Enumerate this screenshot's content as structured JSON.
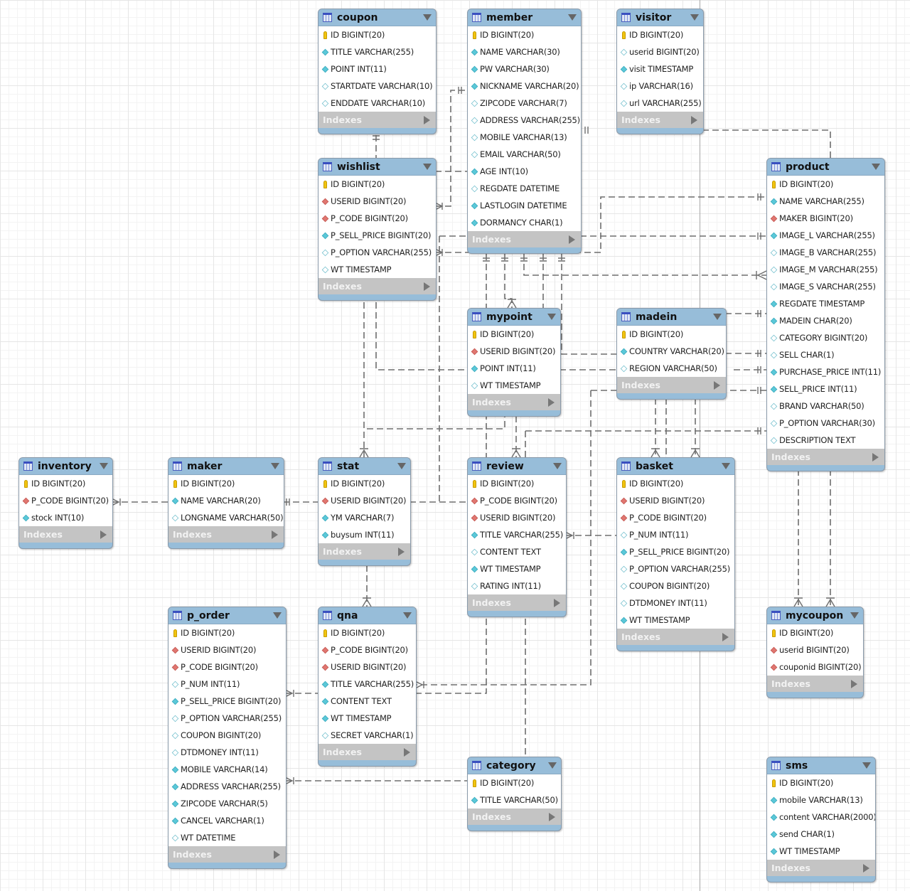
{
  "diagram": {
    "indexes_label": "Indexes",
    "colors": {
      "header": "#97bdd9",
      "primary_key": "#f1c40f",
      "foreign_key": "#e07670",
      "not_null": "#5bc8d8",
      "nullable": "#ffffff",
      "relationship_line": "#6e6e6e"
    },
    "tables": [
      {
        "name": "coupon",
        "columns": [
          {
            "text": "ID BIGINT(20)",
            "kind": "pk"
          },
          {
            "text": "TITLE VARCHAR(255)",
            "kind": "nn"
          },
          {
            "text": "POINT INT(11)",
            "kind": "nn"
          },
          {
            "text": "STARTDATE VARCHAR(10)",
            "kind": "nul"
          },
          {
            "text": "ENDDATE VARCHAR(10)",
            "kind": "nul"
          }
        ]
      },
      {
        "name": "member",
        "columns": [
          {
            "text": "ID BIGINT(20)",
            "kind": "pk"
          },
          {
            "text": "NAME VARCHAR(30)",
            "kind": "nn"
          },
          {
            "text": "PW VARCHAR(30)",
            "kind": "nn"
          },
          {
            "text": "NICKNAME VARCHAR(20)",
            "kind": "nn"
          },
          {
            "text": "ZIPCODE VARCHAR(7)",
            "kind": "nul"
          },
          {
            "text": "ADDRESS VARCHAR(255)",
            "kind": "nul"
          },
          {
            "text": "MOBILE VARCHAR(13)",
            "kind": "nul"
          },
          {
            "text": "EMAIL VARCHAR(50)",
            "kind": "nul"
          },
          {
            "text": "AGE INT(10)",
            "kind": "nn"
          },
          {
            "text": "REGDATE DATETIME",
            "kind": "nul"
          },
          {
            "text": "LASTLOGIN DATETIME",
            "kind": "nn"
          },
          {
            "text": "DORMANCY CHAR(1)",
            "kind": "nn"
          }
        ]
      },
      {
        "name": "visitor",
        "columns": [
          {
            "text": "ID BIGINT(20)",
            "kind": "pk"
          },
          {
            "text": "userid BIGINT(20)",
            "kind": "nul"
          },
          {
            "text": "visit TIMESTAMP",
            "kind": "nn"
          },
          {
            "text": "ip VARCHAR(16)",
            "kind": "nul"
          },
          {
            "text": "url VARCHAR(255)",
            "kind": "nul"
          }
        ]
      },
      {
        "name": "wishlist",
        "columns": [
          {
            "text": "ID BIGINT(20)",
            "kind": "pk"
          },
          {
            "text": "USERID BIGINT(20)",
            "kind": "fk"
          },
          {
            "text": "P_CODE BIGINT(20)",
            "kind": "fk"
          },
          {
            "text": "P_SELL_PRICE BIGINT(20)",
            "kind": "nn"
          },
          {
            "text": "P_OPTION VARCHAR(255)",
            "kind": "nul"
          },
          {
            "text": "WT TIMESTAMP",
            "kind": "nul"
          }
        ]
      },
      {
        "name": "product",
        "columns": [
          {
            "text": "ID BIGINT(20)",
            "kind": "pk"
          },
          {
            "text": "NAME VARCHAR(255)",
            "kind": "nn"
          },
          {
            "text": "MAKER BIGINT(20)",
            "kind": "fk"
          },
          {
            "text": "IMAGE_L VARCHAR(255)",
            "kind": "nn"
          },
          {
            "text": "IMAGE_B VARCHAR(255)",
            "kind": "nul"
          },
          {
            "text": "IMAGE_M VARCHAR(255)",
            "kind": "nul"
          },
          {
            "text": "IMAGE_S VARCHAR(255)",
            "kind": "nul"
          },
          {
            "text": "REGDATE TIMESTAMP",
            "kind": "nn"
          },
          {
            "text": "MADEIN CHAR(20)",
            "kind": "nn"
          },
          {
            "text": "CATEGORY BIGINT(20)",
            "kind": "nul"
          },
          {
            "text": "SELL CHAR(1)",
            "kind": "nul"
          },
          {
            "text": "PURCHASE_PRICE INT(11)",
            "kind": "nn"
          },
          {
            "text": "SELL_PRICE INT(11)",
            "kind": "nn"
          },
          {
            "text": "BRAND VARCHAR(50)",
            "kind": "nul"
          },
          {
            "text": "P_OPTION VARCHAR(30)",
            "kind": "nul"
          },
          {
            "text": "DESCRIPTION TEXT",
            "kind": "nul"
          }
        ]
      },
      {
        "name": "mypoint",
        "columns": [
          {
            "text": "ID BIGINT(20)",
            "kind": "pk"
          },
          {
            "text": "USERID BIGINT(20)",
            "kind": "fk"
          },
          {
            "text": "POINT INT(11)",
            "kind": "nn"
          },
          {
            "text": "WT TIMESTAMP",
            "kind": "nul"
          }
        ]
      },
      {
        "name": "madein",
        "columns": [
          {
            "text": "ID BIGINT(20)",
            "kind": "pk"
          },
          {
            "text": "COUNTRY VARCHAR(20)",
            "kind": "nn"
          },
          {
            "text": "REGION VARCHAR(50)",
            "kind": "nul"
          }
        ]
      },
      {
        "name": "inventory",
        "columns": [
          {
            "text": "ID BIGINT(20)",
            "kind": "pk"
          },
          {
            "text": "P_CODE BIGINT(20)",
            "kind": "fk"
          },
          {
            "text": "stock INT(10)",
            "kind": "nn"
          }
        ]
      },
      {
        "name": "maker",
        "columns": [
          {
            "text": "ID BIGINT(20)",
            "kind": "pk"
          },
          {
            "text": "NAME VARCHAR(20)",
            "kind": "nn"
          },
          {
            "text": "LONGNAME VARCHAR(50)",
            "kind": "nul"
          }
        ]
      },
      {
        "name": "stat",
        "columns": [
          {
            "text": "ID BIGINT(20)",
            "kind": "pk"
          },
          {
            "text": "USERID BIGINT(20)",
            "kind": "fk"
          },
          {
            "text": "YM VARCHAR(7)",
            "kind": "nn"
          },
          {
            "text": "buysum INT(11)",
            "kind": "nn"
          }
        ]
      },
      {
        "name": "review",
        "columns": [
          {
            "text": "ID BIGINT(20)",
            "kind": "pk"
          },
          {
            "text": "P_CODE BIGINT(20)",
            "kind": "fk"
          },
          {
            "text": "USERID BIGINT(20)",
            "kind": "fk"
          },
          {
            "text": "TITLE VARCHAR(255)",
            "kind": "nn"
          },
          {
            "text": "CONTENT TEXT",
            "kind": "nul"
          },
          {
            "text": "WT TIMESTAMP",
            "kind": "nn"
          },
          {
            "text": "RATING INT(11)",
            "kind": "nul"
          }
        ]
      },
      {
        "name": "basket",
        "columns": [
          {
            "text": "ID BIGINT(20)",
            "kind": "pk"
          },
          {
            "text": "USERID BIGINT(20)",
            "kind": "fk"
          },
          {
            "text": "P_CODE BIGINT(20)",
            "kind": "fk"
          },
          {
            "text": "P_NUM INT(11)",
            "kind": "nul"
          },
          {
            "text": "P_SELL_PRICE BIGINT(20)",
            "kind": "nn"
          },
          {
            "text": "P_OPTION VARCHAR(255)",
            "kind": "nul"
          },
          {
            "text": "COUPON BIGINT(20)",
            "kind": "nul"
          },
          {
            "text": "DTDMONEY INT(11)",
            "kind": "nul"
          },
          {
            "text": "WT TIMESTAMP",
            "kind": "nn"
          }
        ]
      },
      {
        "name": "p_order",
        "columns": [
          {
            "text": "ID BIGINT(20)",
            "kind": "pk"
          },
          {
            "text": "USERID BIGINT(20)",
            "kind": "fk"
          },
          {
            "text": "P_CODE BIGINT(20)",
            "kind": "fk"
          },
          {
            "text": "P_NUM INT(11)",
            "kind": "nul"
          },
          {
            "text": "P_SELL_PRICE BIGINT(20)",
            "kind": "nn"
          },
          {
            "text": "P_OPTION VARCHAR(255)",
            "kind": "nul"
          },
          {
            "text": "COUPON BIGINT(20)",
            "kind": "nul"
          },
          {
            "text": "DTDMONEY INT(11)",
            "kind": "nul"
          },
          {
            "text": "MOBILE VARCHAR(14)",
            "kind": "nn"
          },
          {
            "text": "ADDRESS VARCHAR(255)",
            "kind": "nn"
          },
          {
            "text": "ZIPCODE VARCHAR(5)",
            "kind": "nn"
          },
          {
            "text": "CANCEL VARCHAR(1)",
            "kind": "nn"
          },
          {
            "text": "WT DATETIME",
            "kind": "nul"
          }
        ]
      },
      {
        "name": "qna",
        "columns": [
          {
            "text": "ID BIGINT(20)",
            "kind": "pk"
          },
          {
            "text": "P_CODE BIGINT(20)",
            "kind": "fk"
          },
          {
            "text": "USERID BIGINT(20)",
            "kind": "fk"
          },
          {
            "text": "TITLE VARCHAR(255)",
            "kind": "nn"
          },
          {
            "text": "CONTENT TEXT",
            "kind": "nn"
          },
          {
            "text": "WT TIMESTAMP",
            "kind": "nn"
          },
          {
            "text": "SECRET VARCHAR(1)",
            "kind": "nul"
          }
        ]
      },
      {
        "name": "category",
        "columns": [
          {
            "text": "ID BIGINT(20)",
            "kind": "pk"
          },
          {
            "text": "TITLE VARCHAR(50)",
            "kind": "nn"
          }
        ]
      },
      {
        "name": "mycoupon",
        "columns": [
          {
            "text": "ID BIGINT(20)",
            "kind": "pk"
          },
          {
            "text": "userid BIGINT(20)",
            "kind": "fk"
          },
          {
            "text": "couponid BIGINT(20)",
            "kind": "fk"
          }
        ]
      },
      {
        "name": "sms",
        "columns": [
          {
            "text": "ID BIGINT(20)",
            "kind": "pk"
          },
          {
            "text": "mobile VARCHAR(13)",
            "kind": "nn"
          },
          {
            "text": "content VARCHAR(2000)",
            "kind": "nn"
          },
          {
            "text": "send CHAR(1)",
            "kind": "nn"
          },
          {
            "text": "WT TIMESTAMP",
            "kind": "nn"
          }
        ]
      }
    ],
    "relationships": [
      {
        "from": "wishlist",
        "to": "member",
        "cardinality": "many-to-one"
      },
      {
        "from": "wishlist",
        "to": "product",
        "cardinality": "many-to-one"
      },
      {
        "from": "coupon",
        "to": "wishlist",
        "cardinality": "one-to-one"
      },
      {
        "from": "visitor",
        "to": "product",
        "cardinality": "one-to-one"
      },
      {
        "from": "mypoint",
        "to": "member",
        "cardinality": "many-to-one"
      },
      {
        "from": "product",
        "to": "maker",
        "cardinality": "many-to-one"
      },
      {
        "from": "product",
        "to": "madein",
        "cardinality": "many-to-one"
      },
      {
        "from": "product",
        "to": "category",
        "cardinality": "many-to-one"
      },
      {
        "from": "inventory",
        "to": "maker",
        "cardinality": "many-to-one"
      },
      {
        "from": "stat",
        "to": "member",
        "cardinality": "many-to-one"
      },
      {
        "from": "review",
        "to": "member",
        "cardinality": "many-to-one"
      },
      {
        "from": "review",
        "to": "product",
        "cardinality": "many-to-one"
      },
      {
        "from": "basket",
        "to": "member",
        "cardinality": "many-to-one"
      },
      {
        "from": "basket",
        "to": "product",
        "cardinality": "many-to-one"
      },
      {
        "from": "qna",
        "to": "member",
        "cardinality": "many-to-one"
      },
      {
        "from": "qna",
        "to": "product",
        "cardinality": "many-to-one"
      },
      {
        "from": "p_order",
        "to": "member",
        "cardinality": "many-to-one"
      },
      {
        "from": "p_order",
        "to": "product",
        "cardinality": "many-to-one"
      },
      {
        "from": "mycoupon",
        "to": "product",
        "cardinality": "many-to-one"
      }
    ]
  }
}
